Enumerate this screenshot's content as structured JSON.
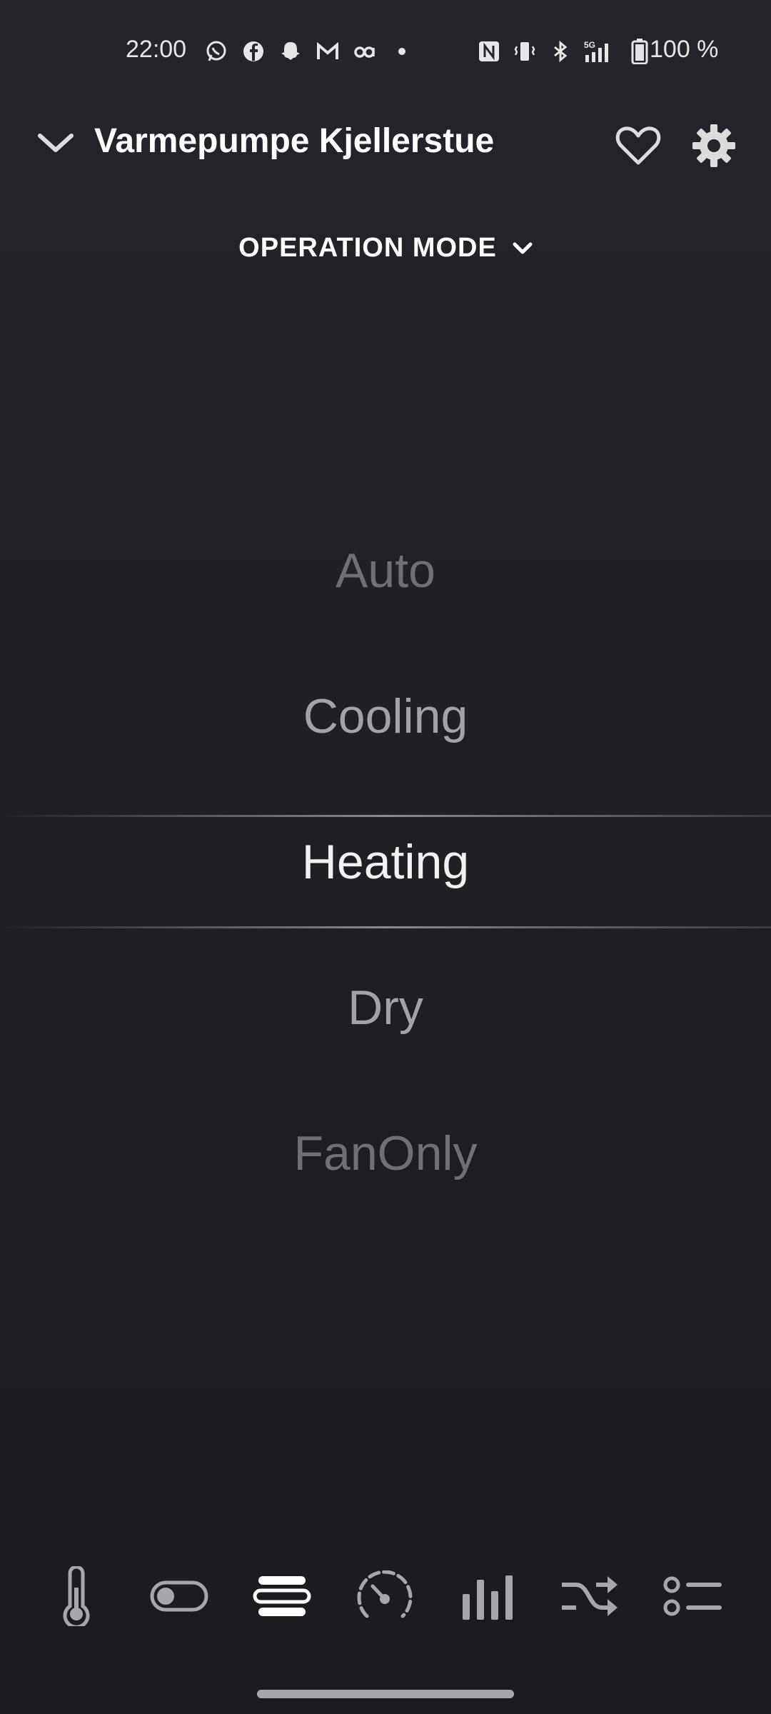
{
  "status_bar": {
    "time": "22:00",
    "battery": "100 %",
    "network": "5G",
    "notification_icons": [
      "whatsapp-icon",
      "facebook-icon",
      "snapchat-icon",
      "gmail-icon",
      "oa-icon",
      "dot-icon"
    ],
    "system_icons": [
      "nfc-icon",
      "vibrate-icon",
      "bluetooth-icon",
      "signal-icon",
      "battery-icon"
    ]
  },
  "header": {
    "title": "Varmepumpe Kjellerstue"
  },
  "mode_selector": {
    "label": "OPERATION MODE"
  },
  "picker": {
    "items": [
      "Auto",
      "Cooling",
      "Heating",
      "Dry",
      "FanOnly"
    ],
    "selected": "Heating"
  },
  "bottom_nav": {
    "items": [
      "thermometer-icon",
      "toggle-icon",
      "operation-mode-icon",
      "gauge-icon",
      "bar-chart-icon",
      "shuffle-icon",
      "list-icon"
    ],
    "active": "operation-mode-icon"
  },
  "colors": {
    "background": "#1f2024",
    "text_primary": "#ffffff",
    "text_muted": "#6f7074",
    "icon_inactive": "#a6a7ab"
  }
}
